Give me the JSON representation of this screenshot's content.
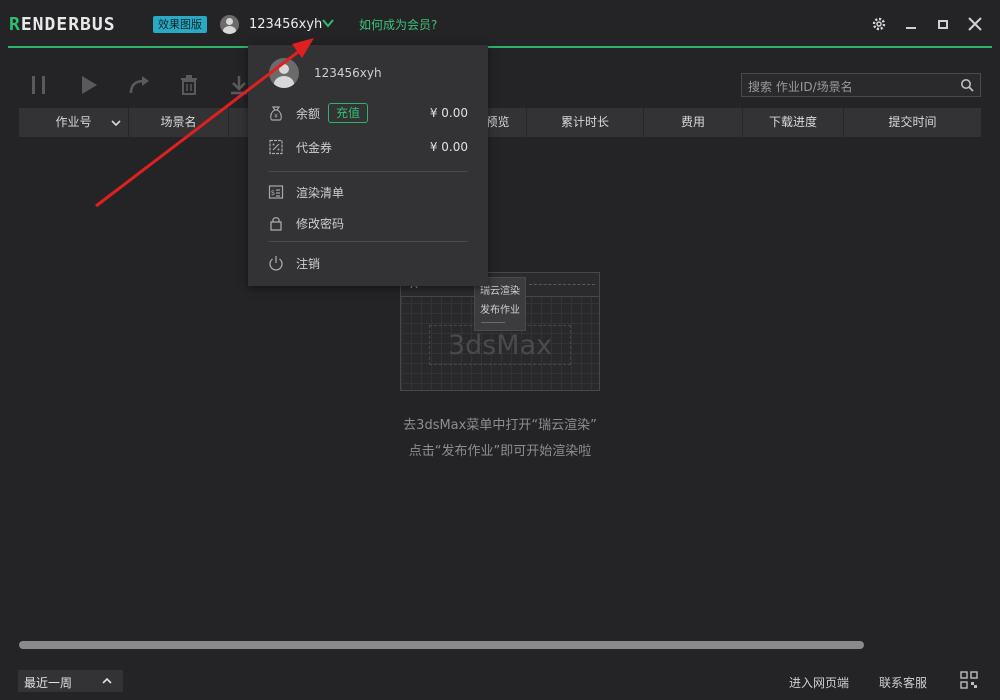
{
  "app": {
    "logo_prefix": "R",
    "logo_rest": "ENDERBUS",
    "edition": "效果图版",
    "username": "123456xyh",
    "member_link": "如何成为会员?"
  },
  "search": {
    "placeholder": "搜索 作业ID/场景名"
  },
  "table": {
    "columns": [
      "作业号",
      "场景名",
      "",
      "",
      "预览",
      "累计时长",
      "费用",
      "下载进度",
      "提交时间"
    ]
  },
  "dropdown": {
    "username": "123456xyh",
    "balance_label": "余额",
    "recharge_label": "充值",
    "balance_value": "¥ 0.00",
    "voucher_label": "代金券",
    "voucher_value": "¥ 0.00",
    "render_list_label": "渲染清单",
    "change_password_label": "修改密码",
    "logout_label": "注销"
  },
  "empty_state": {
    "illus_menu_1": "瑞云渲染",
    "illus_menu_2": "发布作业",
    "illus_app": "3dsMax",
    "line1": "去3dsMax菜单中打开“瑞云渲染”",
    "line2": "点击“发布作业”即可开始渲染啦"
  },
  "footer": {
    "period": "最近一周",
    "web_link": "进入网页端",
    "support_link": "联系客服"
  },
  "colors": {
    "accent": "#2fb36a",
    "badge": "#29a9c4",
    "arrow": "#e02020"
  }
}
